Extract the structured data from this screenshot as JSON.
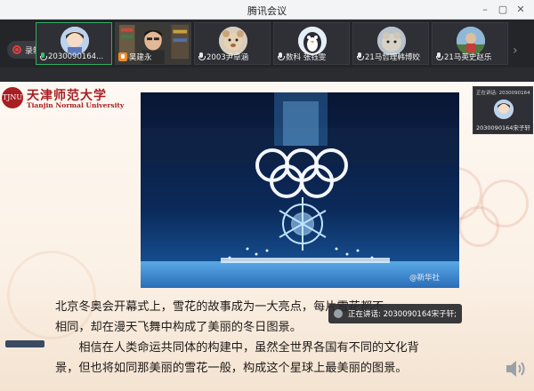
{
  "window": {
    "title": "腾讯会议"
  },
  "recording": {
    "label": "录制中"
  },
  "participants": [
    {
      "name": "2030090164...",
      "mic": "green",
      "active": true
    },
    {
      "name": "吴建永",
      "mic": "hand",
      "active": false
    },
    {
      "name": "2003尹卓涵",
      "mic": "normal",
      "active": false
    },
    {
      "name": "数科 张钰雯",
      "mic": "normal",
      "active": false
    },
    {
      "name": "21马哲理韩博姣",
      "mic": "normal",
      "active": false
    },
    {
      "name": "21马英史赵乐",
      "mic": "normal",
      "active": false
    }
  ],
  "self_view": {
    "speaking_label": "正在讲话: 2030090164宋子轩",
    "name": "2030090164宋子轩"
  },
  "slide": {
    "logo_cn": "天津师范大学",
    "logo_en": "Tianjin Normal University",
    "seal_text": "TJNU",
    "watermark": "@新华社",
    "paragraph_lines": [
      "北京冬奥会开幕式上，雪花的故事成为一大亮点，每片雪花都不",
      "相同，却在漫天飞舞中构成了美丽的冬日图景。",
      "　　相信在人类命运共同体的构建中，虽然全世界各国有不同的文化背",
      "景，但也将如同那美丽的雪花一般，构成这个星球上最美丽的图景。"
    ]
  },
  "toast": {
    "text": "正在讲话: 2030090164宋子轩;"
  },
  "colors": {
    "accent_green": "#2fae60",
    "brand_red": "#a81e22",
    "hand_orange": "#f08b2a"
  }
}
